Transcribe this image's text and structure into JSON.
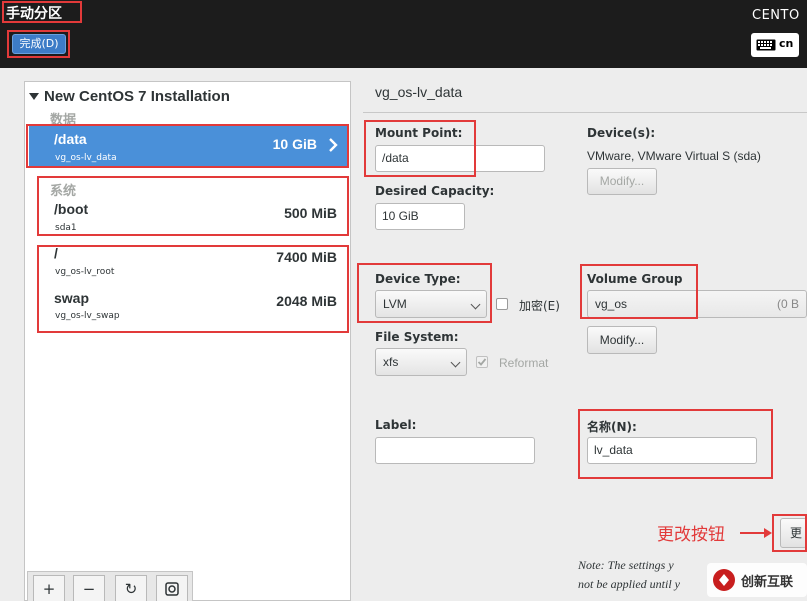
{
  "header": {
    "title": "手动分区",
    "done_label": "完成(D)",
    "product": "CENTO",
    "keyboard_layout": "cn"
  },
  "left": {
    "installation_title": "New CentOS 7 Installation",
    "groups": [
      {
        "label": "数据"
      },
      {
        "label": "系统"
      }
    ],
    "rows": [
      {
        "mount": "/data",
        "device": "vg_os-lv_data",
        "size": "10 GiB"
      },
      {
        "mount": "/boot",
        "device": "sda1",
        "size": "500 MiB"
      },
      {
        "mount": "/",
        "device": "vg_os-lv_root",
        "size": "7400 MiB"
      },
      {
        "mount": "swap",
        "device": "vg_os-lv_swap",
        "size": "2048 MiB"
      }
    ],
    "toolbar": {
      "add": "+",
      "remove": "−",
      "refresh": "↻"
    }
  },
  "detail": {
    "section_title": "vg_os-lv_data",
    "mount_point_label": "Mount Point:",
    "mount_point_value": "/data",
    "desired_capacity_label": "Desired Capacity:",
    "desired_capacity_value": "10 GiB",
    "devices_label": "Device(s):",
    "devices_value": "VMware, VMware Virtual S (sda)",
    "modify_label": "Modify...",
    "device_type_label": "Device Type:",
    "device_type_value": "LVM",
    "encrypt_label": "加密(E)",
    "volume_group_label": "Volume Group",
    "volume_group_value": "vg_os",
    "volume_group_free": "(0 B",
    "modify2_label": "Modify...",
    "file_system_label": "File System:",
    "file_system_value": "xfs",
    "reformat_label": "Reformat",
    "label_label": "Label:",
    "label_value": "",
    "name_label": "名称(N):",
    "name_value": "lv_data",
    "update_btn_label": "更",
    "note_line1": "Note:  The settings y",
    "note_line2": "not be applied until y"
  },
  "annotation": {
    "update_button_callout": "更改按钮",
    "color": "#e23a3a"
  },
  "watermark": {
    "text": "创新互联"
  }
}
